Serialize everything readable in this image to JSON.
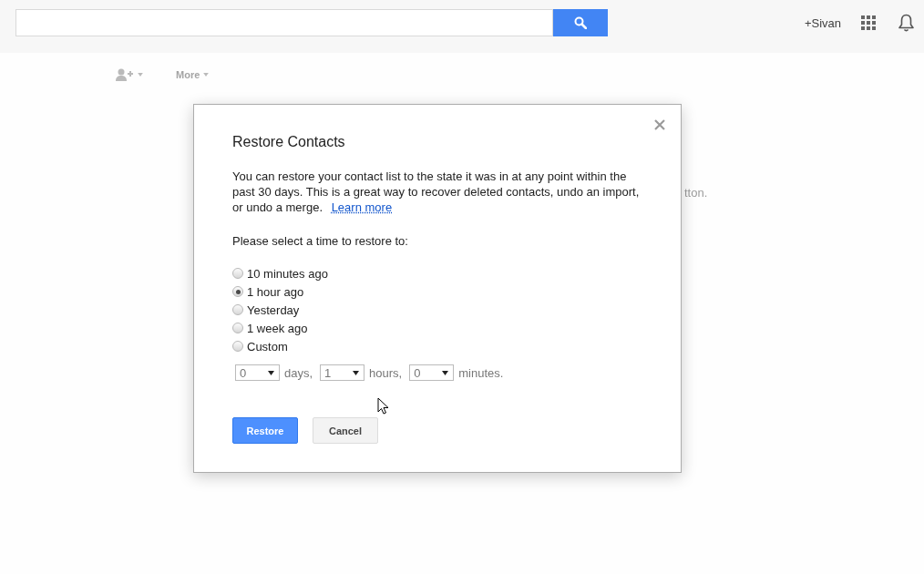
{
  "header": {
    "account": "+Sivan"
  },
  "toolbar": {
    "more": "More"
  },
  "background_text": "tton.",
  "dialog": {
    "title": "Restore Contacts",
    "description": "You can restore your contact list to the state it was in at any point within the past 30 days. This is a great way to recover deleted contacts, undo an import, or undo a merge.",
    "link": "Learn more",
    "prompt": "Please select a time to restore to:",
    "options": [
      {
        "label": "10 minutes ago",
        "selected": false
      },
      {
        "label": "1 hour ago",
        "selected": true
      },
      {
        "label": "Yesterday",
        "selected": false
      },
      {
        "label": "1 week ago",
        "selected": false
      },
      {
        "label": "Custom",
        "selected": false
      }
    ],
    "custom_time": [
      {
        "value": "0",
        "unit": "days,"
      },
      {
        "value": "1",
        "unit": "hours,"
      },
      {
        "value": "0",
        "unit": "minutes."
      }
    ],
    "buttons": [
      {
        "label": "Restore",
        "kind": "primary"
      },
      {
        "label": "Cancel",
        "kind": "secondary"
      }
    ]
  }
}
